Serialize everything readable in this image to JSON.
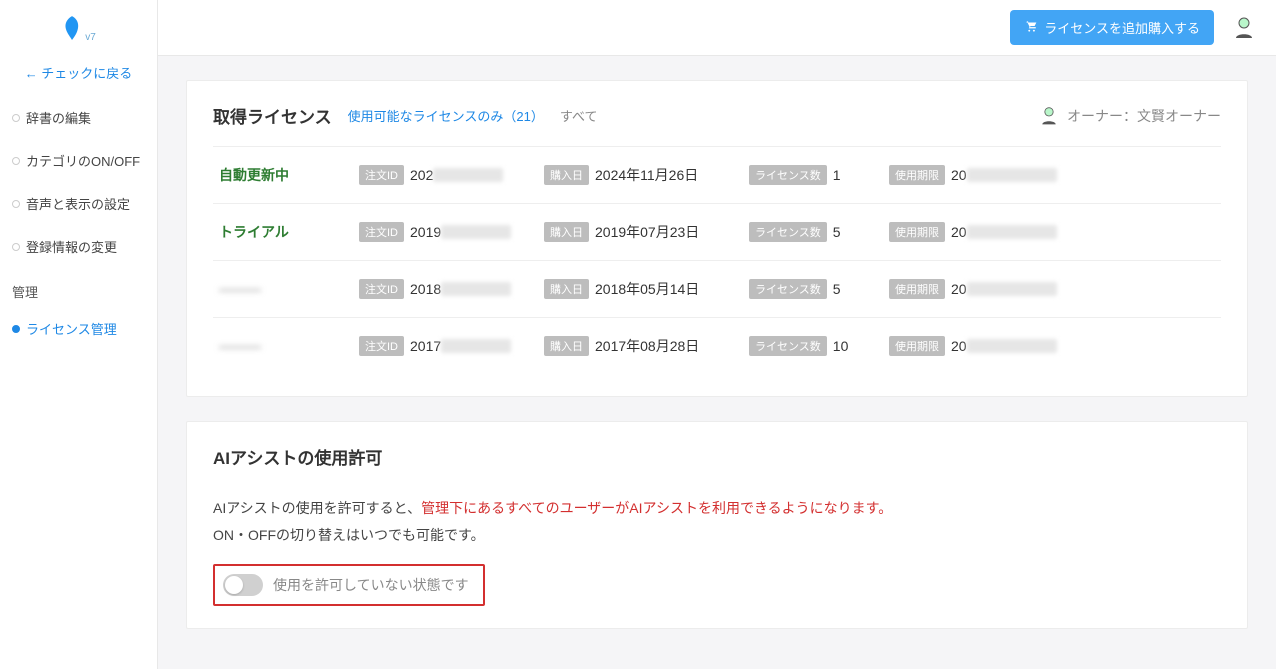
{
  "logo": {
    "version": "v7"
  },
  "back_link": "← チェックに戻る",
  "nav": {
    "items": [
      {
        "label": "辞書の編集"
      },
      {
        "label": "カテゴリのON/OFF"
      },
      {
        "label": "音声と表示の設定"
      },
      {
        "label": "登録情報の変更"
      }
    ],
    "section_label": "管理",
    "active_item": {
      "label": "ライセンス管理"
    }
  },
  "topbar": {
    "buy_label": "ライセンスを追加購入する"
  },
  "licenses": {
    "title": "取得ライセンス",
    "filter_available": "使用可能なライセンスのみ（21）",
    "filter_all": "すべて",
    "owner_label": "オーナー：文賢オーナー",
    "tag_order": "注文ID",
    "tag_buydate": "購入日",
    "tag_count": "ライセンス数",
    "tag_exp": "使用期限",
    "rows": [
      {
        "status": "自動更新中",
        "status_class": "green",
        "order_prefix": "202",
        "buy_date": "2024年11月26日",
        "count": "1",
        "exp_prefix": "20"
      },
      {
        "status": "トライアル",
        "status_class": "green",
        "order_prefix": "2019",
        "buy_date": "2019年07月23日",
        "count": "5",
        "exp_prefix": "20"
      },
      {
        "status": "———",
        "status_class": "blur",
        "order_prefix": "2018",
        "buy_date": "2018年05月14日",
        "count": "5",
        "exp_prefix": "20"
      },
      {
        "status": "———",
        "status_class": "blur",
        "order_prefix": "2017",
        "buy_date": "2017年08月28日",
        "count": "10",
        "exp_prefix": "20"
      }
    ]
  },
  "ai": {
    "title": "AIアシストの使用許可",
    "desc_pre": "AIアシストの使用を許可すると、",
    "desc_red": "管理下にあるすべてのユーザーがAIアシストを利用できるようになります。",
    "desc_line2": "ON・OFFの切り替えはいつでも可能です。",
    "switch_label": "使用を許可していない状態です"
  }
}
